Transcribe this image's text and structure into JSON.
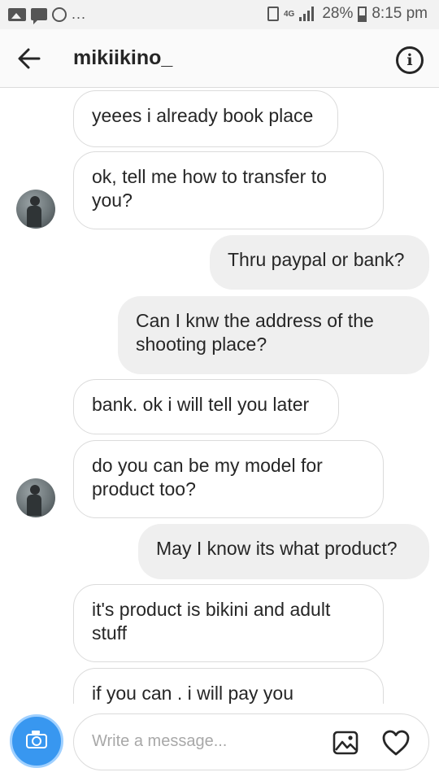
{
  "status_bar": {
    "left_dots": "...",
    "network": "4G",
    "battery": "28%",
    "time": "8:15 pm"
  },
  "header": {
    "username": "mikiikino_",
    "info_icon_glyph": "i"
  },
  "messages": [
    {
      "direction": "incoming",
      "text": "yeees i already book place",
      "avatar": false
    },
    {
      "direction": "incoming",
      "text": "ok, tell me how to transfer to you?",
      "avatar": true
    },
    {
      "direction": "outgoing",
      "text": "Thru paypal or bank?"
    },
    {
      "direction": "outgoing",
      "text": "Can I knw the address of the shooting place?"
    },
    {
      "direction": "incoming",
      "text": "bank. ok i will tell you later",
      "avatar": false
    },
    {
      "direction": "incoming",
      "text": "do you can be my model for product too?",
      "avatar": true
    },
    {
      "direction": "outgoing",
      "text": "May I know its what product?"
    },
    {
      "direction": "incoming",
      "text": "it's product is bikini and adult stuff",
      "avatar": false
    },
    {
      "direction": "incoming",
      "text": "if you can . i will pay you",
      "avatar": false
    }
  ],
  "composer": {
    "placeholder": "Write a message..."
  },
  "icons": {
    "back": "arrow-left-icon",
    "info": "info-icon",
    "camera": "camera-icon",
    "gallery": "image-icon",
    "like": "heart-icon"
  },
  "colors": {
    "accent": "#3897f0",
    "outgoing_bubble": "#efefef",
    "incoming_border": "#dbdbdb",
    "text": "#262626"
  }
}
